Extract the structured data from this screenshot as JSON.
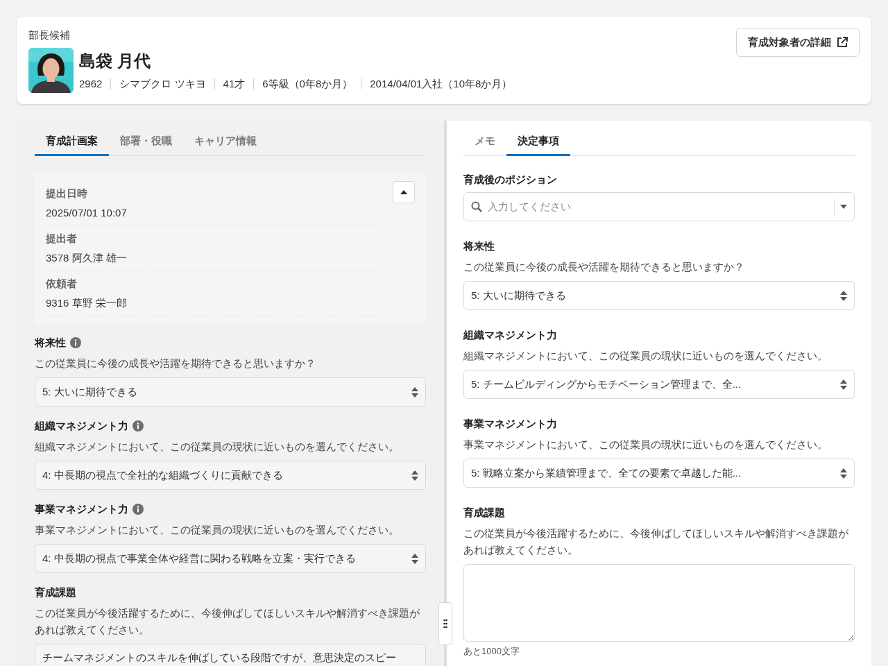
{
  "header": {
    "role": "部長候補",
    "name": "島袋 月代",
    "meta": [
      "2962",
      "シマブクロ ツキヨ",
      "41才",
      "6等級（0年8か月）",
      "2014/04/01入社（10年8か月）"
    ],
    "detail_button": "育成対象者の詳細"
  },
  "left": {
    "tabs": [
      {
        "label": "育成計画案",
        "selected": true
      },
      {
        "label": "部署・役職",
        "selected": false
      },
      {
        "label": "キャリア情報",
        "selected": false
      }
    ],
    "submission": {
      "expanded": true,
      "rows": [
        {
          "label": "提出日時",
          "value": "2025/07/01 10:07"
        },
        {
          "label": "提出者",
          "value": "3578 阿久津 雄一"
        },
        {
          "label": "依頼者",
          "value": "9316 草野 栄一郎"
        }
      ]
    },
    "fields": [
      {
        "kind": "select",
        "label": "将来性",
        "info": true,
        "question": "この従業員に今後の成長や活躍を期待できると思いますか？",
        "value": "5: 大いに期待できる"
      },
      {
        "kind": "select",
        "label": "組織マネジメント力",
        "info": true,
        "question": "組織マネジメントにおいて、この従業員の現状に近いものを選んでください。",
        "value": "4: 中長期の視点で全社的な組織づくりに貢献できる"
      },
      {
        "kind": "select",
        "label": "事業マネジメント力",
        "info": true,
        "question": "事業マネジメントにおいて、この従業員の現状に近いものを選んでください。",
        "value": "4: 中長期の視点で事業全体や経営に関わる戦略を立案・実行できる"
      },
      {
        "kind": "textarea",
        "label": "育成課題",
        "info": false,
        "question": "この従業員が今後活躍するために、今後伸ばしてほしいスキルや解消すべき課題があれば教えてください。",
        "value": "チームマネジメントのスキルを伸ばしている段階ですが、意思決定のスピー"
      }
    ]
  },
  "right": {
    "tabs": [
      {
        "label": "メモ",
        "selected": false
      },
      {
        "label": "決定事項",
        "selected": true
      }
    ],
    "fields": [
      {
        "kind": "combobox",
        "label": "育成後のポジション",
        "info": false,
        "placeholder": "入力してください"
      },
      {
        "kind": "select",
        "label": "将来性",
        "info": false,
        "question": "この従業員に今後の成長や活躍を期待できると思いますか？",
        "value": "5: 大いに期待できる"
      },
      {
        "kind": "select",
        "label": "組織マネジメント力",
        "info": false,
        "question": "組織マネジメントにおいて、この従業員の現状に近いものを選んでください。",
        "value": "5: チームビルディングからモチベーション管理まで、全..."
      },
      {
        "kind": "select",
        "label": "事業マネジメント力",
        "info": false,
        "question": "事業マネジメントにおいて、この従業員の現状に近いものを選んでください。",
        "value": "5: 戦略立案から業績管理まで、全ての要素で卓越した能..."
      },
      {
        "kind": "textarea",
        "label": "育成課題",
        "info": false,
        "question": "この従業員が今後活躍するために、今後伸ばしてほしいスキルや解消すべき課題があれば教えてください。",
        "counter": "あと1000文字"
      }
    ]
  }
}
